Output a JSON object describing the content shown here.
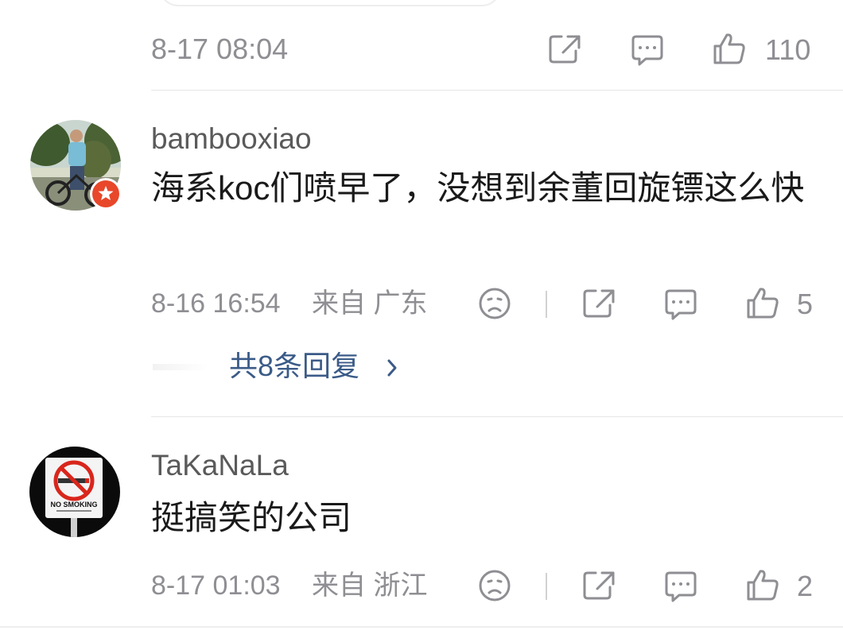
{
  "colors": {
    "meta_gray": "#8e8e93",
    "link_blue": "#3b5b88",
    "divider": "#e6e6e6",
    "badge_red": "#e8472a"
  },
  "top_item": {
    "timestamp": "8-17 08:04",
    "like_count": "110",
    "icons": [
      "share-icon",
      "comment-icon",
      "like-icon"
    ]
  },
  "comments": [
    {
      "username": "bambooxiao",
      "text": "海系koc们喷早了，没想到余董回旋镖这么快",
      "timestamp": "8-16 16:54",
      "location": "来自 广东",
      "like_count": "5",
      "replies_label": "共8条回复",
      "badge_icon": "verified-badge-icon",
      "icons": [
        "sad-face-icon",
        "share-icon",
        "comment-icon",
        "like-icon"
      ]
    },
    {
      "username": "TaKaNaLa",
      "text": "挺搞笑的公司",
      "timestamp": "8-17 01:03",
      "location": "来自 浙江",
      "like_count": "2",
      "icons": [
        "sad-face-icon",
        "share-icon",
        "comment-icon",
        "like-icon"
      ]
    }
  ],
  "avatar2_sign_text": "NO SMOKING"
}
